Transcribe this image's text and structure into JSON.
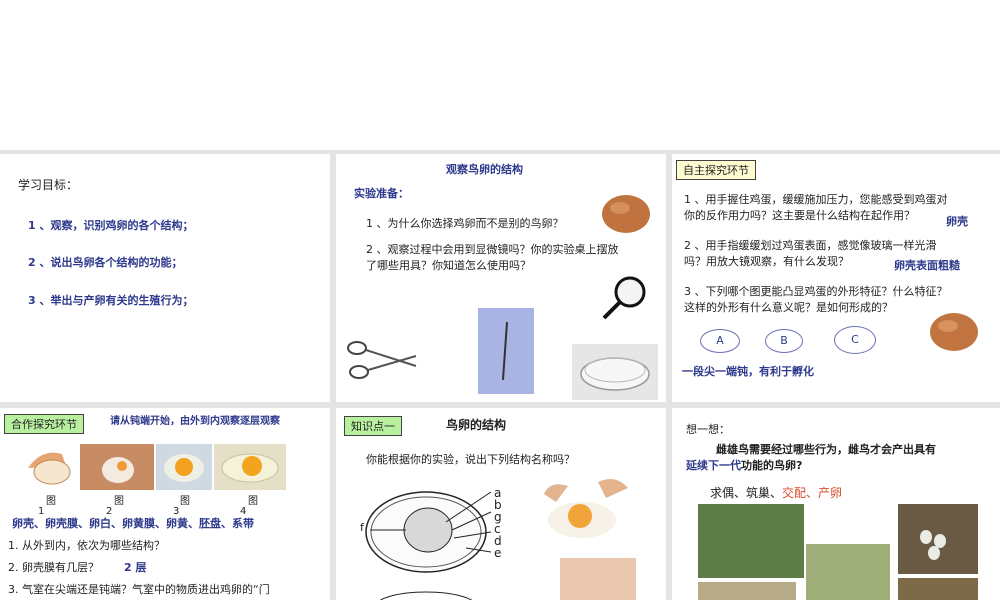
{
  "slide1": {
    "title": "学习目标：",
    "objectives": [
      "1 、观察，识别鸡卵的各个结构；",
      "2 、说出鸟卵各个结构的功能；",
      "3 、举出与产卵有关的生殖行为；"
    ]
  },
  "slide2": {
    "title": "观察鸟卵的结构",
    "prep": "实验准备：",
    "q1": "1 、为什么你选择鸡卵而不是别的鸟卵？",
    "q2a": "2 、观察过程中会用到显微镜吗？你的实验桌上摆放",
    "q2b": "了哪些用具？你知道怎么使用吗？"
  },
  "slide3": {
    "tag": "自主探究环节",
    "q1a": "1 、用手握住鸡蛋，缓缓施加压力，您能感受到鸡蛋对",
    "q1b": "你的反作用力吗？这主要是什么结构在起作用？",
    "a1": "卵壳",
    "q2a": "2 、用手指缓缓划过鸡蛋表面，感觉像玻璃一样光滑",
    "q2b": "吗？用放大镜观察，有什么发现？",
    "a2": "卵壳表面粗糙",
    "q3a": "3 、下列哪个图更能凸显鸡蛋的外形特征？什么特征？",
    "q3b": "这样的外形有什么意义呢？是如何形成的？",
    "options": [
      "A",
      "B",
      "C"
    ],
    "a3": "一段尖一端钝，有利于孵化"
  },
  "slide4": {
    "tag": "合作探究环节",
    "instruction": "请从钝端开始，由外到内观察逐层观察",
    "fig": "图",
    "nums": [
      "1",
      "2",
      "3",
      "4"
    ],
    "answer": "卵壳、卵壳膜、卵白、卵黄膜、卵黄、胚盘、系带",
    "q1": "1. 从外到内，依次为哪些结构？",
    "q2": "2. 卵壳膜有几层？",
    "a2": "2 层",
    "q3": "3. 气室在尖端还是钝端？气室中的物质进出鸡卵的“门"
  },
  "slide5": {
    "tag": "知识点一",
    "title": "鸟卵的结构",
    "prompt": "你能根据你的实验，说出下列结构名称吗？",
    "labels": [
      "a",
      "b",
      "g",
      "c",
      "d",
      "e"
    ],
    "f": "f"
  },
  "slide6": {
    "title": "想一想：",
    "q1": "雌雄鸟需要经过哪些行为，雌鸟才会产出具有",
    "q2a": "延续下一代",
    "q2b": "功能的鸟卵?",
    "behaviors_black": "求偶、筑巢、",
    "behaviors_red": "交配、产卵"
  }
}
